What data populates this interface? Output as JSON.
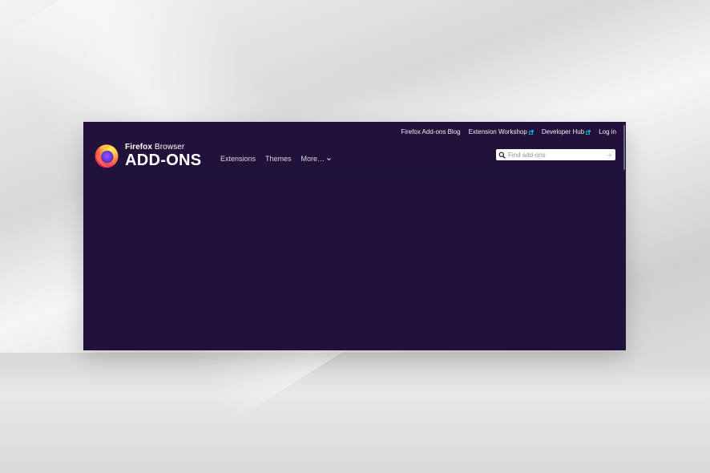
{
  "top_links": [
    {
      "label": "Firefox Add-ons Blog",
      "external": false
    },
    {
      "label": "Extension Workshop",
      "external": true
    },
    {
      "label": "Developer Hub",
      "external": true
    },
    {
      "label": "Log in",
      "external": false
    }
  ],
  "logo": {
    "line1_bold": "Firefox",
    "line1_rest": " Browser",
    "line2": "ADD-ONS"
  },
  "nav": {
    "extensions": "Extensions",
    "themes": "Themes",
    "more": "More…"
  },
  "search": {
    "placeholder": "Find add-ons"
  },
  "colors": {
    "background": "#20123a",
    "link": "#f0eff5",
    "external_icon": "#00ddff"
  }
}
